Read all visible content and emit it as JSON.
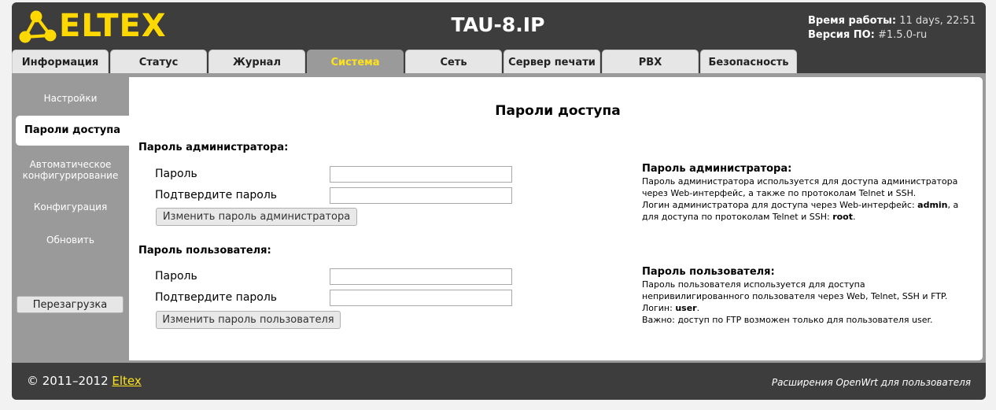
{
  "header": {
    "brand": "ELTEX",
    "device": "TAU-8.IP",
    "uptime_label": "Время работы:",
    "uptime_value": "11 days, 22:51",
    "version_label": "Версия ПО:",
    "version_value": "#1.5.0-ru",
    "brand_color": "#ffd800"
  },
  "tabs": [
    {
      "label": "Информация"
    },
    {
      "label": "Статус"
    },
    {
      "label": "Журнал"
    },
    {
      "label": "Система",
      "active": true
    },
    {
      "label": "Сеть"
    },
    {
      "label": "Сервер печати"
    },
    {
      "label": "PBX"
    },
    {
      "label": "Безопасность"
    }
  ],
  "sidebar": {
    "items": [
      {
        "label": "Настройки"
      },
      {
        "label": "Пароли доступа",
        "active": true
      },
      {
        "label": "Автоматическое конфигурирование"
      },
      {
        "label": "Конфигурация"
      },
      {
        "label": "Обновить"
      }
    ],
    "reboot_label": "Перезагрузка"
  },
  "main": {
    "title": "Пароли доступа",
    "admin": {
      "section_title": "Пароль администратора:",
      "password_label": "Пароль",
      "password_value": "",
      "confirm_label": "Подтвердите пароль",
      "confirm_value": "",
      "button_label": "Изменить пароль администратора"
    },
    "user": {
      "section_title": "Пароль пользователя:",
      "password_label": "Пароль",
      "password_value": "",
      "confirm_label": "Подтвердите пароль",
      "confirm_value": "",
      "button_label": "Изменить пароль пользователя"
    }
  },
  "help": {
    "admin": {
      "title": "Пароль администратора:",
      "line1": "Пароль администратора используется для доступа администратора",
      "line2": "через Web-интерфейс, а также по протоколам Telnet и SSH.",
      "line3_pre": "Логин администратора для доступа через Web-интерфейс: ",
      "line3_bold": "admin",
      "line3_post": ", а",
      "line4_pre": "для доступа по протоколам Telnet и SSH: ",
      "line4_bold": "root",
      "line4_post": "."
    },
    "user": {
      "title": "Пароль пользователя:",
      "line1": "Пароль пользователя используется для доступа",
      "line2": "непривилигированного пользователя через Web, Telnet, SSH и FTP.",
      "line3_pre": "Логин: ",
      "line3_bold": "user",
      "line3_post": ".",
      "line4": "Важно: доступ по FTP возможен только для пользователя user."
    }
  },
  "footer": {
    "copyright": "© 2011–2012 ",
    "company_link": "Eltex",
    "extensions": "Расширения OpenWrt для пользователя"
  }
}
